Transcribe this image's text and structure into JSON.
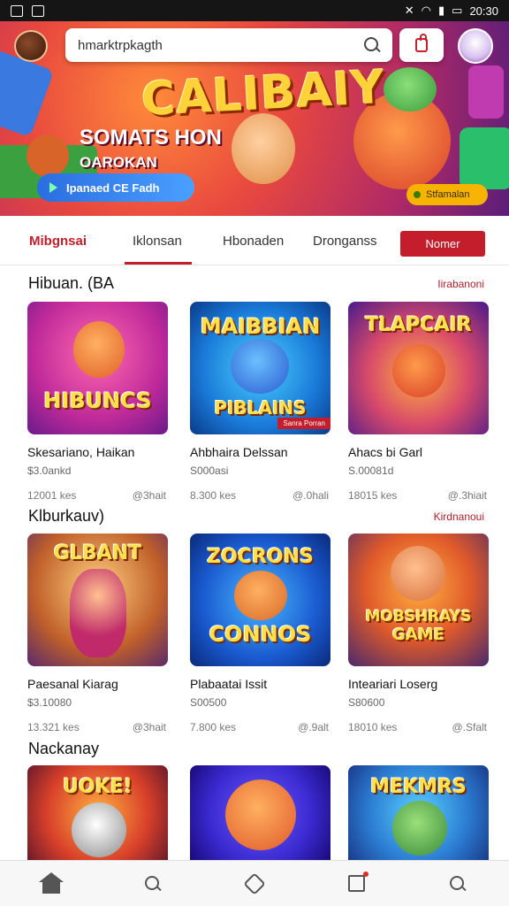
{
  "status_bar": {
    "time": "20:30"
  },
  "header": {
    "search_placeholder": "hmarktrpkagth"
  },
  "hero": {
    "title": "CALIBAIY",
    "subtitle": "SOMATS HON",
    "subtitle2": "OAROKAN",
    "cta_label": "Ipanaed CE Fadh",
    "badge_label": "Stfamalan"
  },
  "tabs": [
    {
      "label": "Mibgnsai"
    },
    {
      "label": "Iklonsan"
    },
    {
      "label": "Hbonaden"
    },
    {
      "label": "Dronganss"
    }
  ],
  "tab_button_label": "Nomer",
  "sections": [
    {
      "title": "Hibuan. (BA",
      "link": "Iirabanoni",
      "cards": [
        {
          "art_text": "HIBUNCS",
          "name": "Skesariano, Haikan",
          "price": "$3.0ankd",
          "count": "12001 kes",
          "rating": "@3hait"
        },
        {
          "art_text": "MAIBBIAN",
          "art_text2": "PIBLAINS",
          "tag": "Sanra Porran",
          "name": "Ahbhaira Delssan",
          "price": "S000asi",
          "count": "8.300 kes",
          "rating": "@.0hali"
        },
        {
          "art_text": "TLAPCAIR",
          "name": "Ahacs bi Garl",
          "price": "S.00081d",
          "count": "18015 kes",
          "rating": "@.3hiait"
        }
      ]
    },
    {
      "title": "Klburkauv)",
      "link": "Kirdnanoui",
      "cards": [
        {
          "art_text": "GLBANT",
          "name": "Paesanal Kiarag",
          "price": "$3.10080",
          "count": "13.321 kes",
          "rating": "@3hait"
        },
        {
          "art_text": "ZOCRONS",
          "art_text2": "CONNOS",
          "name": "Plabaatai Issit",
          "price": "S00500",
          "count": "7.800 kes",
          "rating": "@.9alt"
        },
        {
          "art_text": "MOBSHRAYS",
          "art_text2": "GAME",
          "name": "Inteariari Loserg",
          "price": "S80600",
          "count": "18010 kes",
          "rating": "@.Sfalt"
        }
      ]
    },
    {
      "title": "Nackanay",
      "cards": [
        {
          "art_text": "UOKE!"
        },
        {
          "art_text": ""
        },
        {
          "art_text": "MEKMRS"
        }
      ]
    }
  ],
  "colors": {
    "accent": "#c41e2c"
  }
}
